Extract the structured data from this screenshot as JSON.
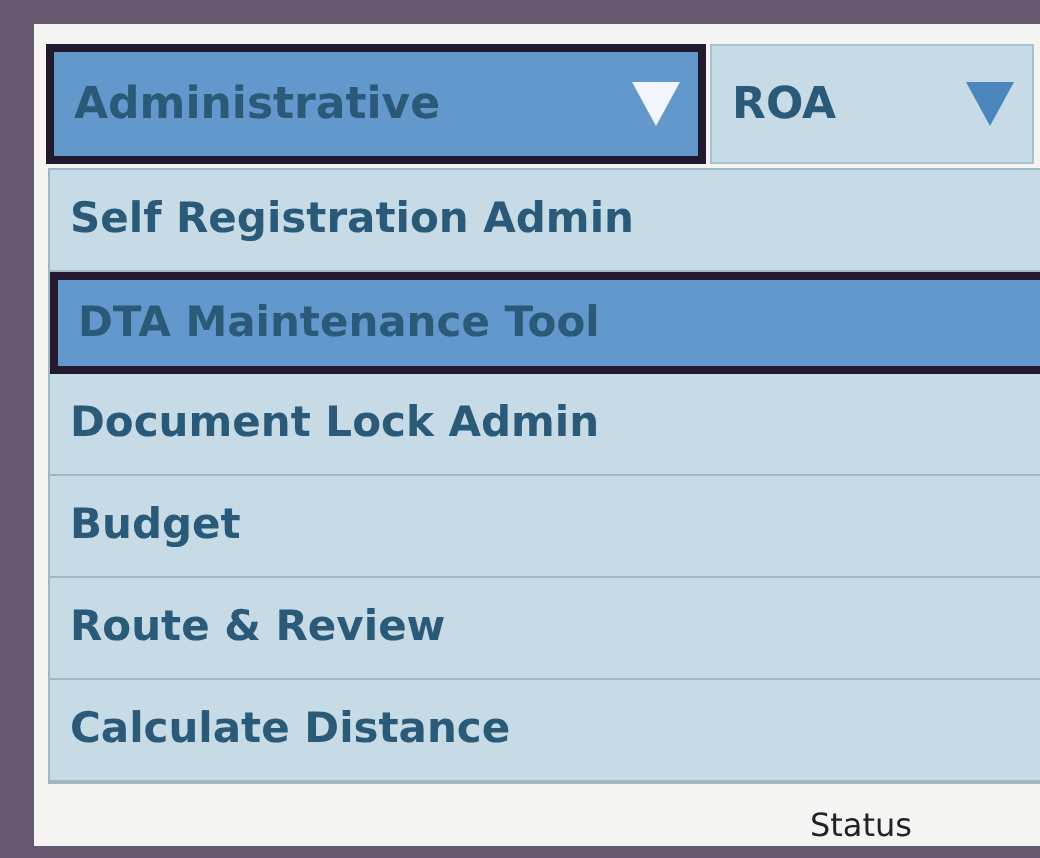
{
  "menu_bar": [
    {
      "label": "Administrative",
      "selected": true
    },
    {
      "label": "ROA",
      "selected": false
    }
  ],
  "dropdown": {
    "items": [
      {
        "label": "Self Registration Admin",
        "selected": false
      },
      {
        "label": "DTA Maintenance Tool",
        "selected": true
      },
      {
        "label": "Document Lock Admin",
        "selected": false
      },
      {
        "label": "Budget",
        "selected": false
      },
      {
        "label": "Route & Review",
        "selected": false
      },
      {
        "label": "Calculate Distance",
        "selected": false
      }
    ]
  },
  "table": {
    "column_header": "Status"
  }
}
